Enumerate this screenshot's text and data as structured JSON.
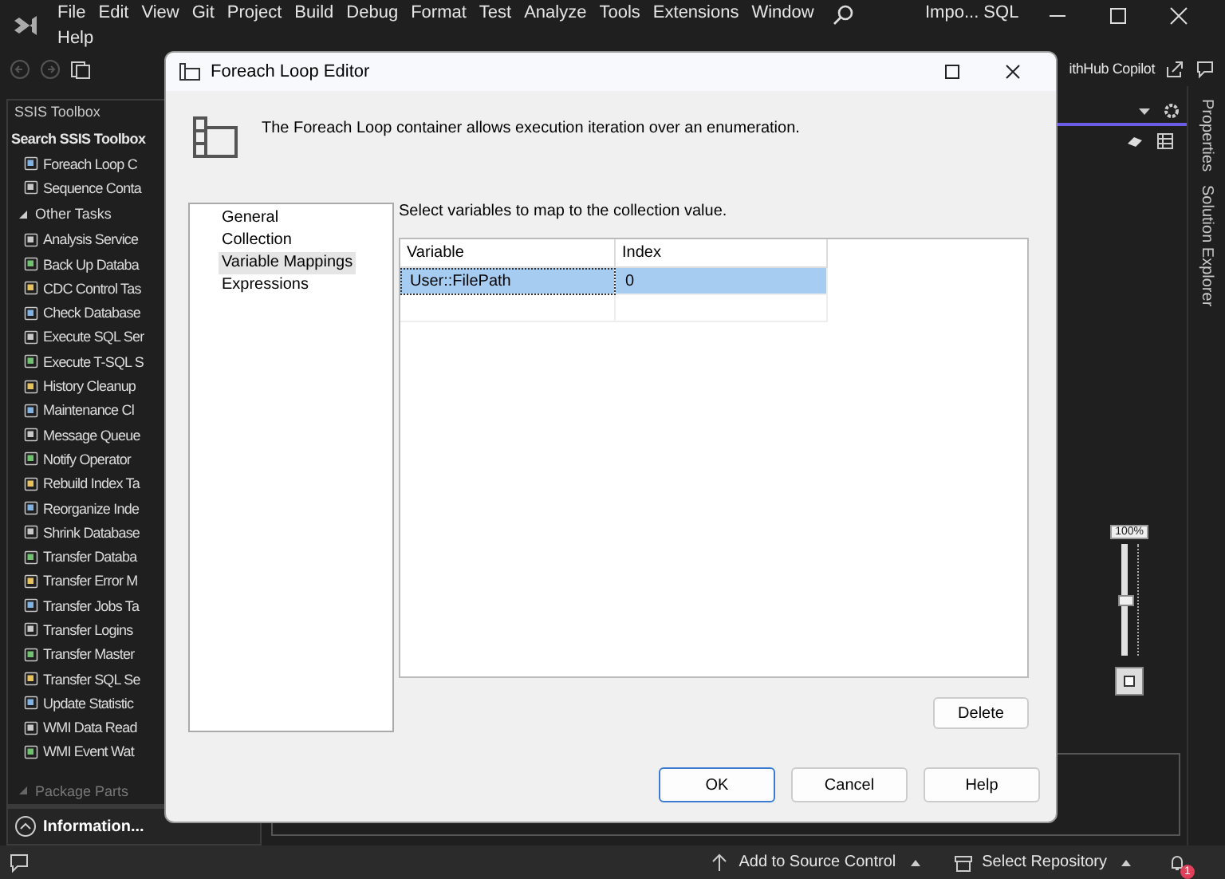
{
  "menu_bar": {
    "items": [
      "File",
      "Edit",
      "View",
      "Git",
      "Project",
      "Build",
      "Debug",
      "Format",
      "Test",
      "Analyze",
      "Tools",
      "Extensions",
      "Window",
      "Help"
    ],
    "title": "Impo... SQL"
  },
  "toolbar": {
    "copilot_label": "ithHub Copilot"
  },
  "toolbox": {
    "title": "SSIS Toolbox",
    "search": {
      "placeholder": "Search SSIS Toolbox"
    },
    "items": [
      "Foreach Loop C",
      "Sequence Conta"
    ],
    "groups": [
      {
        "label": "Other Tasks",
        "expanded": true,
        "items": [
          "Analysis Service",
          "Back Up Databa",
          "CDC Control Tas",
          "Check Database",
          "Execute SQL Ser",
          "Execute T-SQL S",
          "History Cleanup",
          "Maintenance Cl",
          "Message Queue",
          "Notify Operator",
          "Rebuild Index Ta",
          "Reorganize Inde",
          "Shrink Database",
          "Transfer Databa",
          "Transfer Error M",
          "Transfer Jobs Ta",
          "Transfer Logins",
          "Transfer Master",
          "Transfer SQL Se",
          "Update Statistic",
          "WMI Data Read",
          "WMI Event Wat"
        ]
      },
      {
        "label": "Package Parts",
        "expanded": false
      }
    ],
    "info": {
      "label": "Information..."
    }
  },
  "side_tabs": [
    "Properties",
    "Solution Explorer"
  ],
  "zoom": {
    "reading": "100%",
    "level": 0.5
  },
  "dialog": {
    "title": "Foreach Loop Editor",
    "description": "The Foreach Loop container allows execution iteration over an enumeration.",
    "nav": [
      {
        "label": "General",
        "selected": false
      },
      {
        "label": "Collection",
        "selected": false
      },
      {
        "label": "Variable Mappings",
        "selected": true
      },
      {
        "label": "Expressions",
        "selected": false
      }
    ],
    "instruction": "Select variables to map to the collection value.",
    "grid": {
      "columns": [
        "Variable",
        "Index"
      ],
      "rows": [
        {
          "cells": [
            "User::FilePath",
            "0"
          ],
          "selected": true
        }
      ]
    },
    "delete_button": "Delete",
    "buttons": [
      "OK",
      "Cancel",
      "Help"
    ]
  },
  "status_bar": {
    "source_control": "Add to Source Control",
    "repository": "Select Repository",
    "notifications": "1"
  }
}
